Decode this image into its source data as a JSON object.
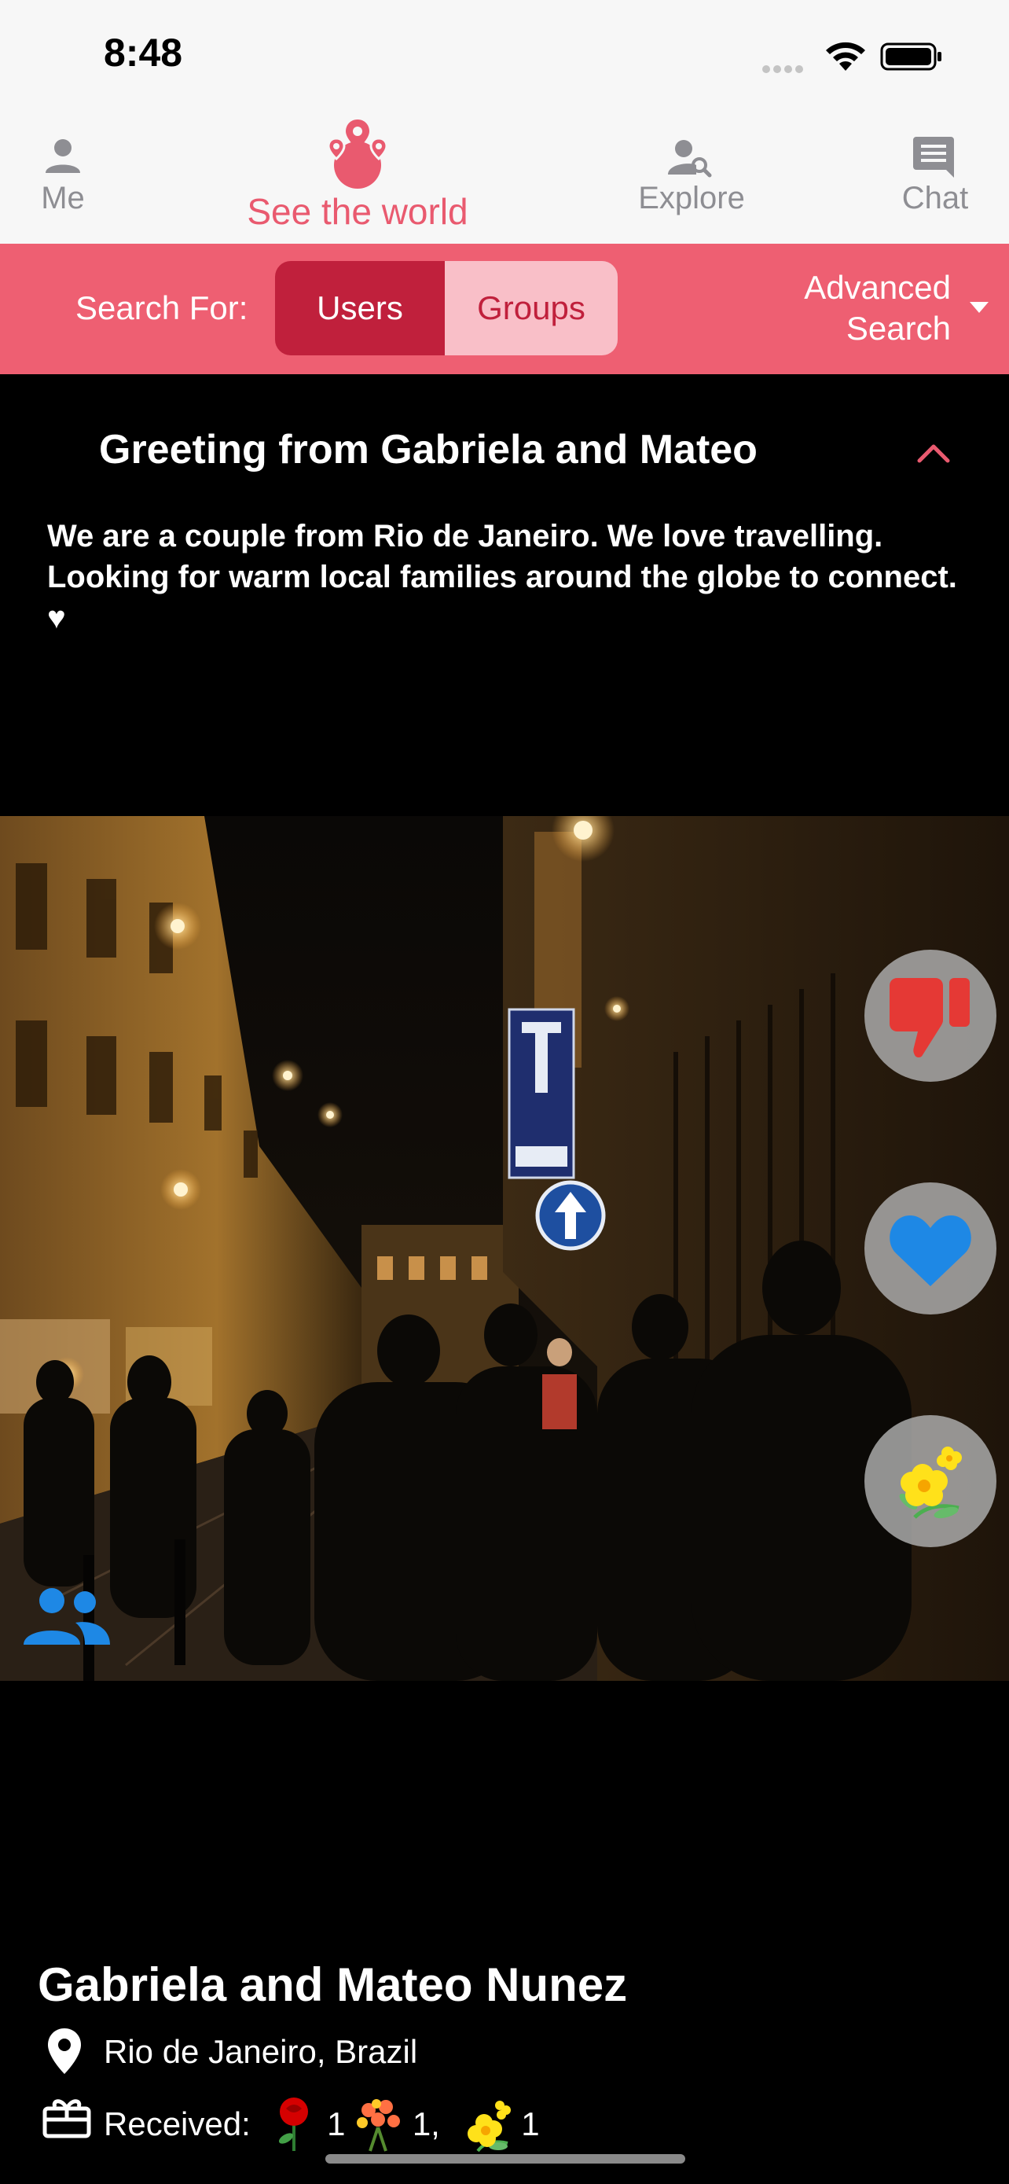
{
  "status_bar": {
    "time": "8:48"
  },
  "top_nav": {
    "items": [
      {
        "label": "Me",
        "icon": "person-icon"
      },
      {
        "label": "See the world",
        "icon": "map-pins-globe-icon",
        "active": true
      },
      {
        "label": "Explore",
        "icon": "person-search-icon"
      },
      {
        "label": "Chat",
        "icon": "chat-bubble-icon"
      }
    ],
    "active_color": "#e95a6f"
  },
  "search": {
    "label": "Search For:",
    "options": [
      "Users",
      "Groups"
    ],
    "selected": "Users",
    "advanced_line1": "Advanced",
    "advanced_line2": "Search",
    "bar_color": "#ee5f72"
  },
  "greeting": {
    "title": "Greeting from Gabriela and Mateo",
    "body": "We are a couple from Rio de Janeiro. We love travelling. Looking for warm local families around the globe to connect. ♥"
  },
  "actions": [
    {
      "name": "dislike",
      "icon": "thumbs-down-icon"
    },
    {
      "name": "like",
      "icon": "heart-icon"
    },
    {
      "name": "send-flower",
      "icon": "flower-icon"
    }
  ],
  "profile": {
    "name": "Gabriela and Mateo Nunez",
    "location": "Rio de Janeiro, Brazil",
    "received_label": "Received:",
    "received": [
      {
        "icon": "rose-icon",
        "count": "1"
      },
      {
        "icon": "bouquet-icon",
        "count": "1,"
      },
      {
        "icon": "yellow-flower-icon",
        "count": "1"
      }
    ]
  }
}
